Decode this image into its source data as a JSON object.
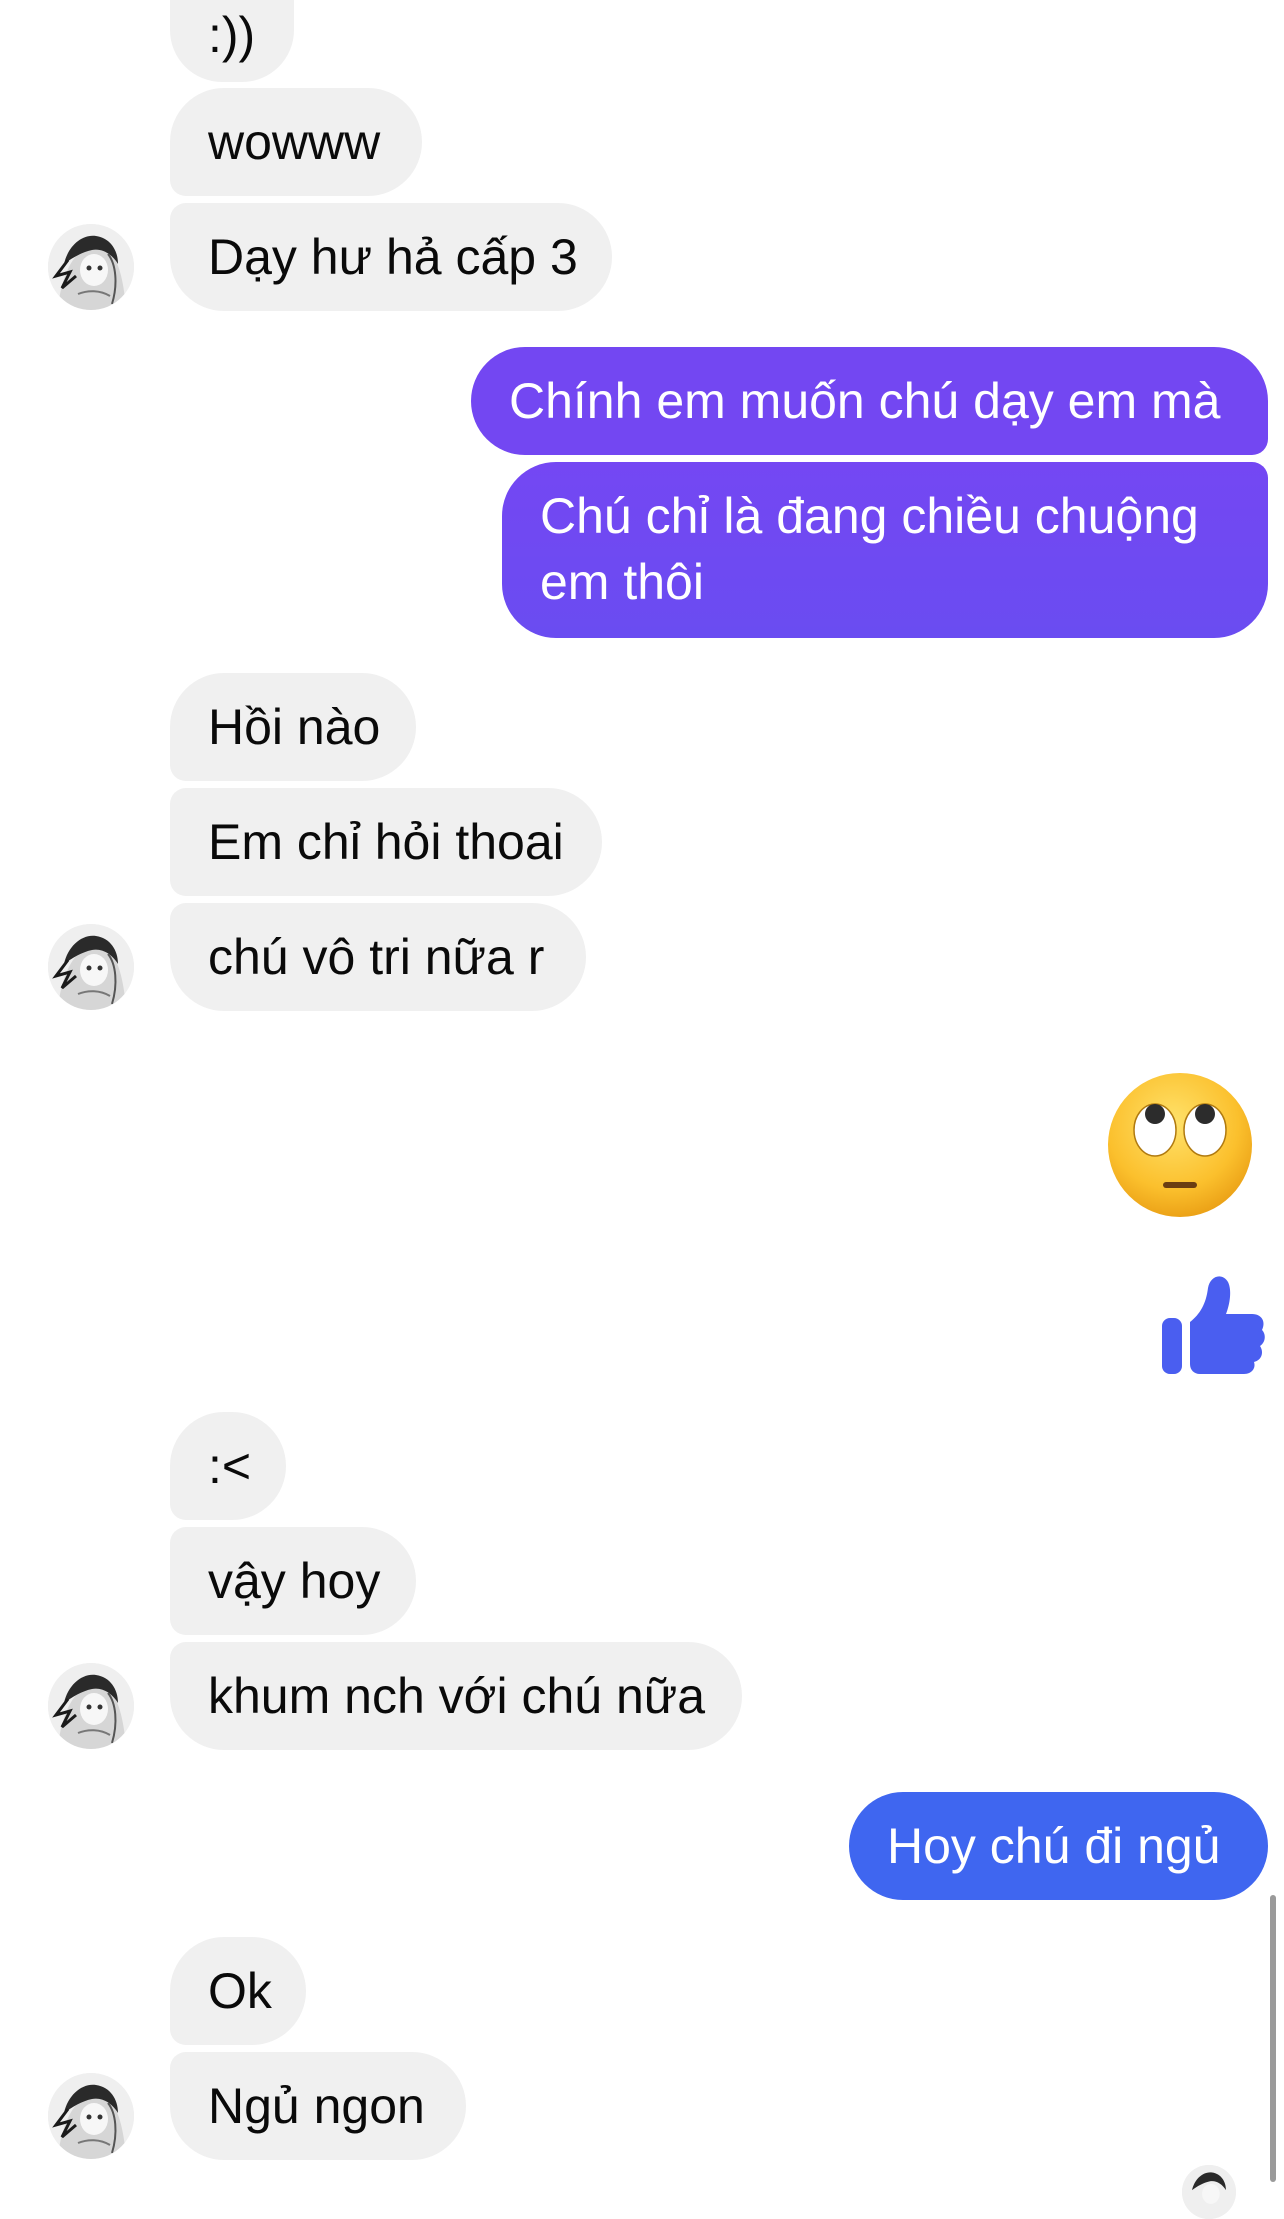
{
  "messages": {
    "m1": ":))",
    "m2": "wowww",
    "m3": "Dạy hư hả cấp 3",
    "m4": "Chính em muốn chú dạy em mà",
    "m5_line1": "Chú chỉ là đang chiều chuộng",
    "m5_line2": "em thôi",
    "m6": "Hồi nào",
    "m7": "Em chỉ hỏi thoai",
    "m8": "chú vô tri nữa r",
    "m9_emoji": "face-with-rolling-eyes",
    "m10_sticker": "thumbs-up",
    "m11": ":<",
    "m12": "vậy hoy",
    "m13": "khum nch với chú nữa",
    "m14": "Hoy chú đi ngủ",
    "m15": "Ok",
    "m16": "Ngủ ngon"
  },
  "colors": {
    "incoming_bubble": "#f0f0f0",
    "outgoing_purple": "#7347f2",
    "outgoing_purple_2": "#6f4af2",
    "outgoing_blue": "#3f66f0",
    "like_blue": "#4a5ef0"
  }
}
